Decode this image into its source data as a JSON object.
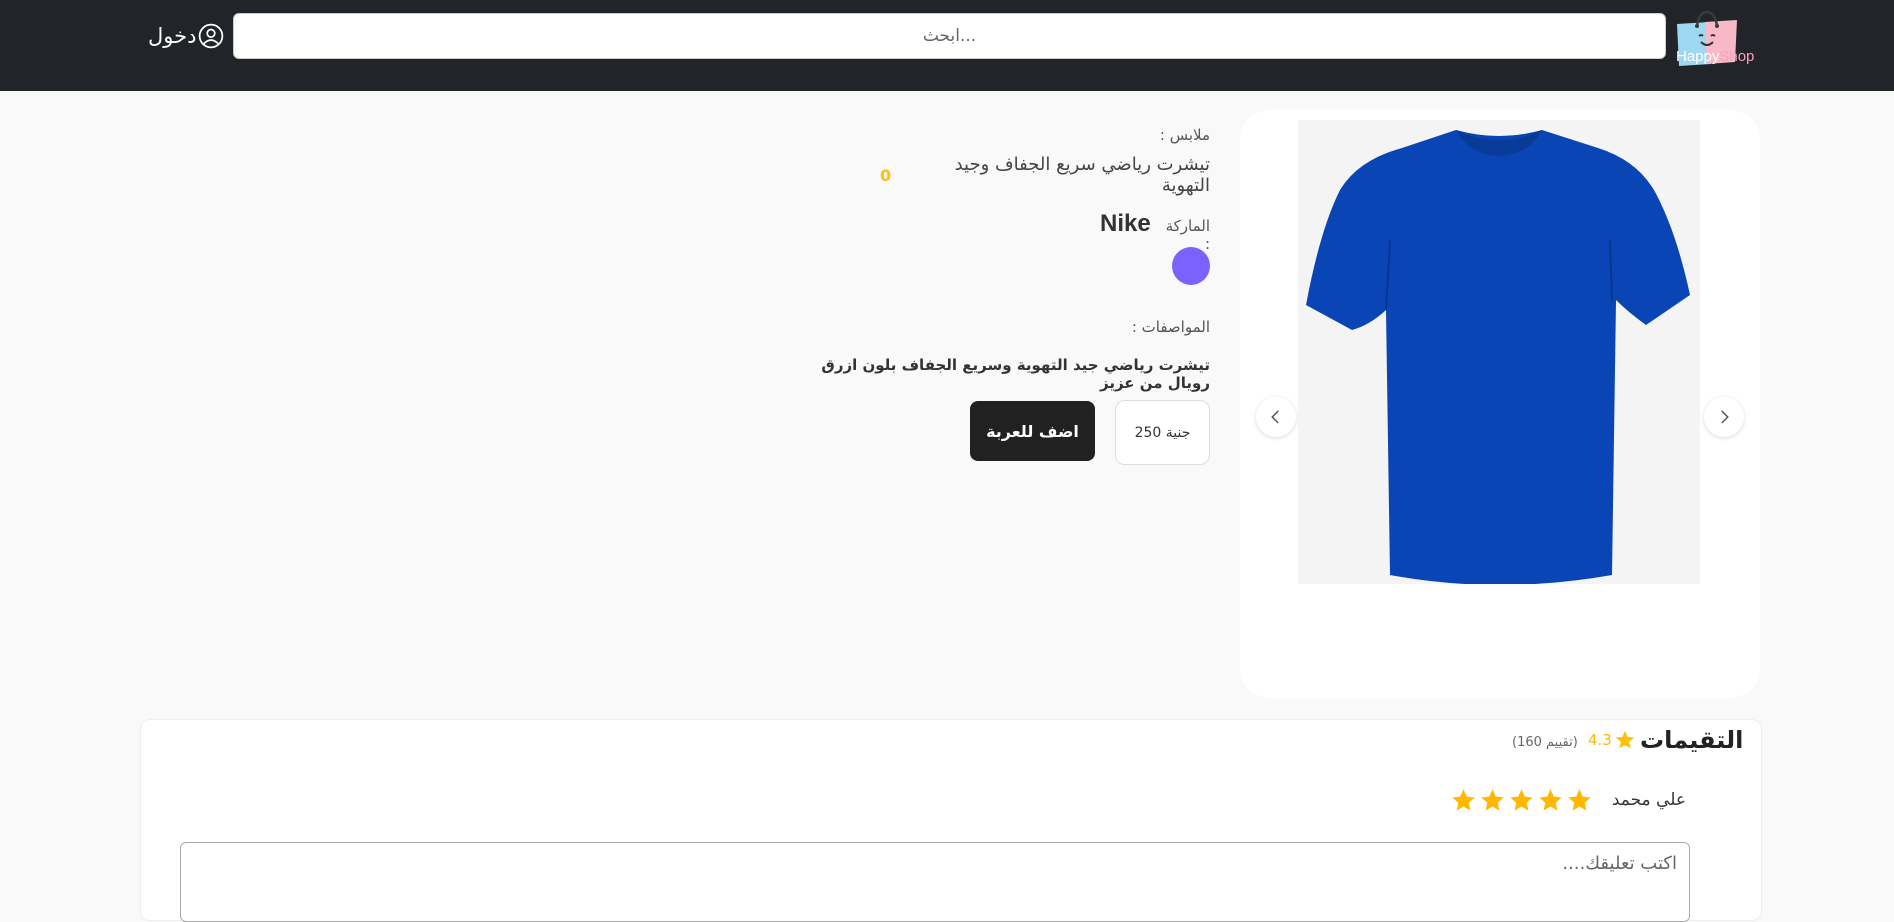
{
  "nav": {
    "logo": {
      "text_happy": "Happy",
      "text_shop": "Shop"
    },
    "search_placeholder": "ابحث...",
    "login_label": "دخول"
  },
  "product": {
    "category": "ملابس :",
    "title": "تيشرت رياضي سريع الجفاف وجيد التهوية",
    "rating": "0",
    "brand_label": "الماركة :",
    "brand": "Nike",
    "color": "#7b61ff",
    "spec_label": "المواصفات :",
    "spec_text": "تيشرت رياضي جيد التهوية وسريع الجفاف بلون ازرق رويال من عزيز",
    "price": "250 جنية",
    "add_to_cart": "اضف للعربة"
  },
  "reviews": {
    "title": "التقيمات",
    "average": "4.3",
    "count": "(160 تقييم)",
    "reviewer_name": "علي محمد",
    "stars": 5,
    "comment_placeholder": "اكتب تعليقك...."
  },
  "colors": {
    "navbar": "#212529",
    "accent_star": "#ffc107",
    "button": "#212121",
    "tshirt": "#0a45b5"
  }
}
